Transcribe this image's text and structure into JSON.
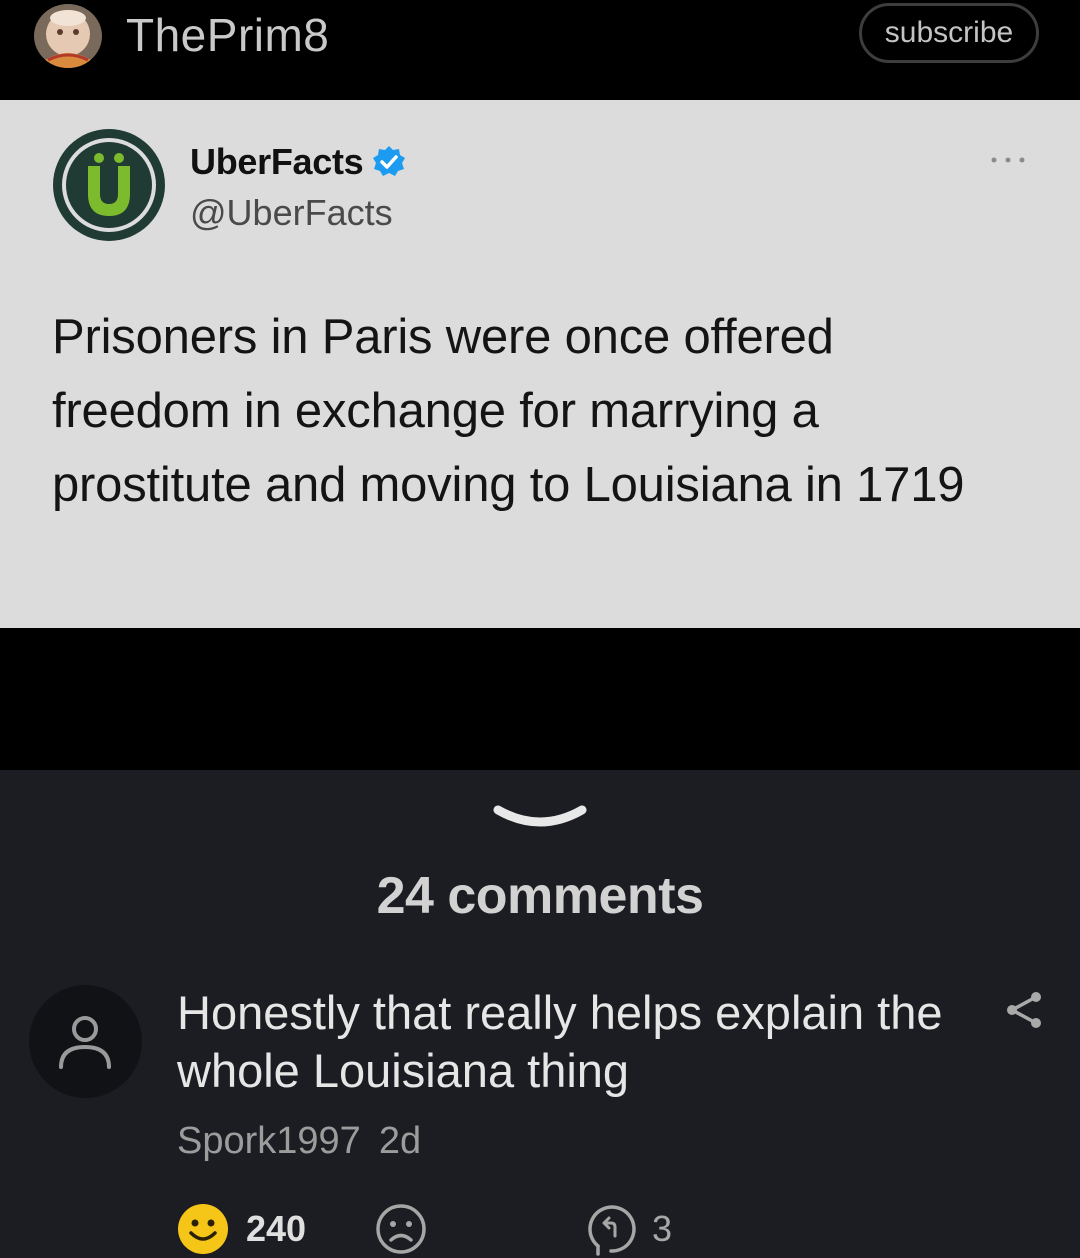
{
  "header": {
    "username": "ThePrim8",
    "subscribe_label": "subscribe"
  },
  "tweet": {
    "display_name": "UberFacts",
    "handle": "@UberFacts",
    "text": "Prisoners in Paris were once offered freedom in exchange for marrying a prostitute and moving to Louisiana in 1719",
    "colors": {
      "background": "#dcdcdc",
      "verified": "#1d9bf0",
      "logo_green": "#7dbb2e",
      "logo_dark": "#1f3b34"
    }
  },
  "comments": {
    "count_label": "24 comments",
    "items": [
      {
        "text": "Honestly that really helps explain the whole Louisiana thing",
        "author": "Spork1997",
        "time": "2d",
        "likes": "240",
        "replies": "3"
      }
    ]
  },
  "icons": {
    "collapse": "chevron-down-icon",
    "share": "share-icon",
    "like": "smiley-icon",
    "dislike": "frown-icon",
    "reply": "reply-icon"
  },
  "colors": {
    "top_bar": "#000000",
    "comments_bg": "#1c1d22",
    "like_yellow": "#f5c518"
  }
}
